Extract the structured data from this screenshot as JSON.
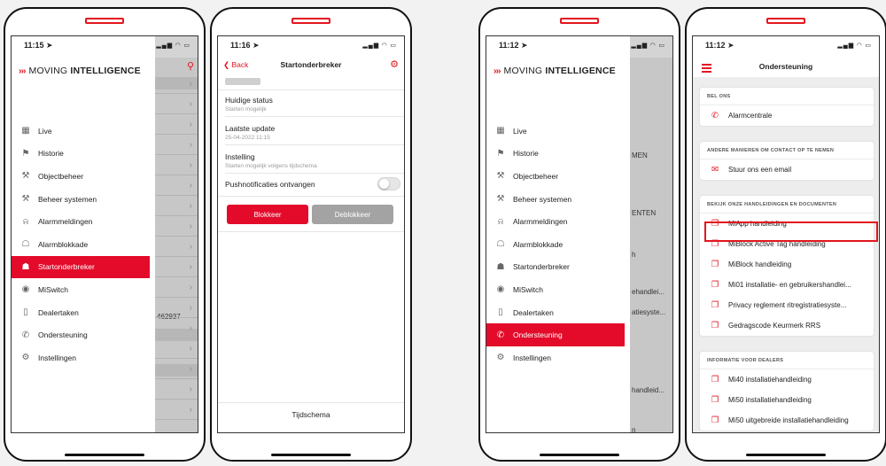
{
  "phone1": {
    "time": "11:15",
    "brand": {
      "arrows": "›››",
      "part1": "MOVING",
      "part2": "INTELLIGENCE"
    },
    "ghost_number": "462937",
    "menu": [
      {
        "label": "Live",
        "icon": "map-icon"
      },
      {
        "label": "Historie",
        "icon": "flag-icon"
      },
      {
        "label": "Objectbeheer",
        "icon": "wrench-icon"
      },
      {
        "label": "Beheer systemen",
        "icon": "wrench-icon"
      },
      {
        "label": "Alarmmeldingen",
        "icon": "bell-icon"
      },
      {
        "label": "Alarmblokkade",
        "icon": "lock-icon"
      },
      {
        "label": "Startonderbreker",
        "icon": "unlock-icon",
        "active": true
      },
      {
        "label": "MiSwitch",
        "icon": "signal-icon"
      },
      {
        "label": "Dealertaken",
        "icon": "clipboard-icon"
      },
      {
        "label": "Ondersteuning",
        "icon": "phone-icon"
      },
      {
        "label": "Instellingen",
        "icon": "gear-icon"
      }
    ]
  },
  "phone2": {
    "time": "11:16",
    "back": "Back",
    "title": "Startonderbreker",
    "fields": [
      {
        "label": "Huidige status",
        "value": "Starten mogelijk"
      },
      {
        "label": "Laatste update",
        "value": "25-04-2022 11:15"
      },
      {
        "label": "Instelling",
        "value": "Starten mogelijk volgens tijdschema"
      }
    ],
    "toggle_label": "Pushnotificaties ontvangen",
    "toggle_on": false,
    "block_button": "Blokkeer",
    "unblock_button": "Deblokkeer",
    "tab": "Tijdschema"
  },
  "phone3": {
    "time": "11:12",
    "brand": {
      "arrows": "›››",
      "part1": "MOVING",
      "part2": "INTELLIGENCE"
    },
    "ghost_text": [
      "MEN",
      "ENTEN",
      "h",
      "ehandlei...",
      "atiesyste...",
      "handleid...",
      "n"
    ],
    "menu": [
      {
        "label": "Live",
        "icon": "map-icon"
      },
      {
        "label": "Historie",
        "icon": "flag-icon"
      },
      {
        "label": "Objectbeheer",
        "icon": "wrench-icon"
      },
      {
        "label": "Beheer systemen",
        "icon": "wrench-icon"
      },
      {
        "label": "Alarmmeldingen",
        "icon": "bell-icon"
      },
      {
        "label": "Alarmblokkade",
        "icon": "lock-icon"
      },
      {
        "label": "Startonderbreker",
        "icon": "unlock-icon"
      },
      {
        "label": "MiSwitch",
        "icon": "signal-icon"
      },
      {
        "label": "Dealertaken",
        "icon": "clipboard-icon"
      },
      {
        "label": "Ondersteuning",
        "icon": "phone-icon",
        "active": true
      },
      {
        "label": "Instellingen",
        "icon": "gear-icon"
      }
    ]
  },
  "phone4": {
    "time": "11:12",
    "title": "Ondersteuning",
    "sections": [
      {
        "header": "BEL ONS",
        "items": [
          {
            "label": "Alarmcentrale",
            "icon": "phone-icon"
          }
        ]
      },
      {
        "header": "ANDERE MANIEREN OM CONTACT OP TE NEMEN",
        "items": [
          {
            "label": "Stuur ons een email",
            "icon": "mail-icon"
          }
        ]
      },
      {
        "header": "BEKIJK ONZE HANDLEIDINGEN EN DOCUMENTEN",
        "items": [
          {
            "label": "MiApp handleiding",
            "icon": "document-icon",
            "highlighted": true
          },
          {
            "label": "MiBlock Active Tag handleiding",
            "icon": "document-icon"
          },
          {
            "label": "MiBlock handleiding",
            "icon": "document-icon"
          },
          {
            "label": "Mi01 installatie- en gebruikershandlei...",
            "icon": "document-icon"
          },
          {
            "label": "Privacy reglement ritregistratiesyste...",
            "icon": "document-icon"
          },
          {
            "label": "Gedragscode Keurmerk RRS",
            "icon": "document-icon"
          }
        ]
      },
      {
        "header": "INFORMATIE VOOR DEALERS",
        "items": [
          {
            "label": "Mi40 installatiehandleiding",
            "icon": "document-icon"
          },
          {
            "label": "Mi50 installatiehandleiding",
            "icon": "document-icon"
          },
          {
            "label": "Mi50 uitgebreide installatiehandleiding",
            "icon": "document-icon"
          }
        ]
      }
    ]
  },
  "colors": {
    "accent": "#e30a2a",
    "highlight": "#e2161f",
    "disabled": "#a3a3a3"
  }
}
